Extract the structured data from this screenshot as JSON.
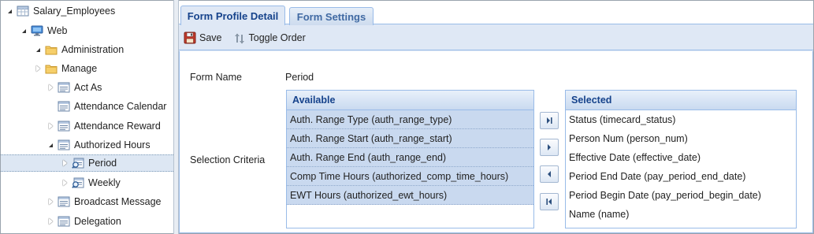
{
  "tree": {
    "root": "Salary_Employees",
    "web": "Web",
    "administration": "Administration",
    "manage": "Manage",
    "items": [
      "Act As",
      "Attendance Calendar",
      "Attendance Reward",
      "Authorized Hours",
      "Period",
      "Weekly",
      "Broadcast Message",
      "Delegation"
    ]
  },
  "tabs": {
    "active": "Form Profile Detail",
    "inactive": "Form Settings"
  },
  "toolbar": {
    "save": "Save",
    "toggle_order": "Toggle Order"
  },
  "form": {
    "form_name_label": "Form Name",
    "form_name_value": "Period",
    "selection_criteria_label": "Selection Criteria"
  },
  "available": {
    "header": "Available",
    "items": [
      "Auth. Range Type (auth_range_type)",
      "Auth. Range Start (auth_range_start)",
      "Auth. Range End (auth_range_end)",
      "Comp Time Hours (authorized_comp_time_hours)",
      "EWT Hours (authorized_ewt_hours)"
    ]
  },
  "selected": {
    "header": "Selected",
    "items": [
      "Status (timecard_status)",
      "Person Num (person_num)",
      "Effective Date (effective_date)",
      "Period End Date (pay_period_end_date)",
      "Period Begin Date (pay_period_begin_date)",
      "Name (name)"
    ]
  },
  "icons": {
    "save": "floppy-disk-icon",
    "toggle_order": "toggle-order-icon",
    "move_all_right": "move-all-right-icon",
    "move_right": "move-right-icon",
    "move_left": "move-left-icon",
    "move_all_left": "move-all-left-icon"
  },
  "colors": {
    "accent": "#15428b",
    "panel": "#dfe8f5",
    "highlight": "#c9d9ef"
  }
}
